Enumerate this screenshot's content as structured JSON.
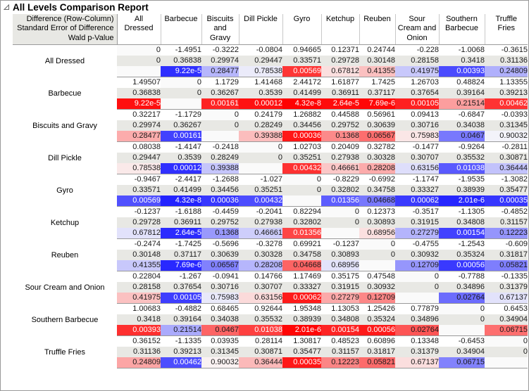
{
  "window": {
    "title": "All Levels Comparison Report",
    "disclosure_icon": "triangle-collapse-icon"
  },
  "table": {
    "legend_lines": [
      "Difference (Row-Column)",
      "Standard Error of Difference",
      "Wald p-Value"
    ],
    "columns": [
      "All Dressed",
      "Barbecue",
      "Biscuits and Gravy",
      "Dill Pickle",
      "Gyro",
      "Ketchup",
      "Reuben",
      "Sour Cream and Onion",
      "Southern Barbecue",
      "Truffle Fries"
    ],
    "rows": [
      {
        "label": "All Dressed",
        "difference": [
          "0",
          "-1.4951",
          "-0.3222",
          "-0.0804",
          "0.94665",
          "0.12371",
          "0.24744",
          "-0.228",
          "-1.0068",
          "-0.3615"
        ],
        "std_error": [
          "0",
          "0.36838",
          "0.29974",
          "0.29447",
          "0.33571",
          "0.29728",
          "0.30148",
          "0.28158",
          "0.3418",
          "0.31136"
        ],
        "p_value": [
          "",
          "9.22e-5",
          "0.28477",
          "0.78538",
          "0.00569",
          "0.67812",
          "0.41355",
          "0.41975",
          "0.00393",
          "0.24809"
        ]
      },
      {
        "label": "Barbecue",
        "difference": [
          "1.49507",
          "0",
          "1.1729",
          "1.41468",
          "2.44172",
          "1.61877",
          "1.7425",
          "1.26703",
          "0.48824",
          "1.13355"
        ],
        "std_error": [
          "0.36838",
          "0",
          "0.36267",
          "0.3539",
          "0.41499",
          "0.36911",
          "0.37117",
          "0.37654",
          "0.39164",
          "0.39213"
        ],
        "p_value": [
          "9.22e-5",
          "",
          "0.00161",
          "0.00012",
          "4.32e-8",
          "2.64e-5",
          "7.69e-6",
          "0.00105",
          "0.21514",
          "0.00462"
        ]
      },
      {
        "label": "Biscuits and Gravy",
        "difference": [
          "0.32217",
          "-1.1729",
          "0",
          "0.24179",
          "1.26882",
          "0.44588",
          "0.56961",
          "0.09413",
          "-0.6847",
          "-0.0393"
        ],
        "std_error": [
          "0.29974",
          "0.36267",
          "0",
          "0.28249",
          "0.34456",
          "0.29752",
          "0.30639",
          "0.30716",
          "0.34038",
          "0.31345"
        ],
        "p_value": [
          "0.28477",
          "0.00161",
          "",
          "0.39388",
          "0.00036",
          "0.1368",
          "0.06567",
          "0.75983",
          "0.0467",
          "0.90032"
        ]
      },
      {
        "label": "Dill Pickle",
        "difference": [
          "0.08038",
          "-1.4147",
          "-0.2418",
          "0",
          "1.02703",
          "0.20409",
          "0.32782",
          "-0.1477",
          "-0.9264",
          "-0.2811"
        ],
        "std_error": [
          "0.29447",
          "0.3539",
          "0.28249",
          "0",
          "0.35251",
          "0.27938",
          "0.30328",
          "0.30707",
          "0.35532",
          "0.30871"
        ],
        "p_value": [
          "0.78538",
          "0.00012",
          "0.39388",
          "",
          "0.00432",
          "0.46661",
          "0.28208",
          "0.63156",
          "0.01038",
          "0.36444"
        ]
      },
      {
        "label": "Gyro",
        "difference": [
          "-0.9467",
          "-2.4417",
          "-1.2688",
          "-1.027",
          "0",
          "-0.8229",
          "-0.6992",
          "-1.1747",
          "-1.9535",
          "-1.3082"
        ],
        "std_error": [
          "0.33571",
          "0.41499",
          "0.34456",
          "0.35251",
          "0",
          "0.32802",
          "0.34758",
          "0.33327",
          "0.38939",
          "0.35477"
        ],
        "p_value": [
          "0.00569",
          "4.32e-8",
          "0.00036",
          "0.00432",
          "",
          "0.01356",
          "0.04668",
          "0.00062",
          "2.01e-6",
          "0.00035"
        ]
      },
      {
        "label": "Ketchup",
        "difference": [
          "-0.1237",
          "-1.6188",
          "-0.4459",
          "-0.2041",
          "0.82294",
          "0",
          "0.12373",
          "-0.3517",
          "-1.1305",
          "-0.4852"
        ],
        "std_error": [
          "0.29728",
          "0.36911",
          "0.29752",
          "0.27938",
          "0.32802",
          "0",
          "0.30893",
          "0.31915",
          "0.34808",
          "0.31157"
        ],
        "p_value": [
          "0.67812",
          "2.64e-5",
          "0.1368",
          "0.46661",
          "0.01356",
          "",
          "0.68956",
          "0.27279",
          "0.00154",
          "0.12223"
        ]
      },
      {
        "label": "Reuben",
        "difference": [
          "-0.2474",
          "-1.7425",
          "-0.5696",
          "-0.3278",
          "0.69921",
          "-0.1237",
          "0",
          "-0.4755",
          "-1.2543",
          "-0.609"
        ],
        "std_error": [
          "0.30148",
          "0.37117",
          "0.30639",
          "0.30328",
          "0.34758",
          "0.30893",
          "0",
          "0.30932",
          "0.35324",
          "0.31817"
        ],
        "p_value": [
          "0.41355",
          "7.69e-6",
          "0.06567",
          "0.28208",
          "0.04668",
          "0.68956",
          "",
          "0.12709",
          "0.00056",
          "0.05821"
        ]
      },
      {
        "label": "Sour Cream and Onion",
        "difference": [
          "0.22804",
          "-1.267",
          "-0.0941",
          "0.14766",
          "1.17469",
          "0.35175",
          "0.47548",
          "0",
          "-0.7788",
          "-0.1335"
        ],
        "std_error": [
          "0.28158",
          "0.37654",
          "0.30716",
          "0.30707",
          "0.33327",
          "0.31915",
          "0.30932",
          "0",
          "0.34896",
          "0.31379"
        ],
        "p_value": [
          "0.41975",
          "0.00105",
          "0.75983",
          "0.63156",
          "0.00062",
          "0.27279",
          "0.12709",
          "",
          "0.02764",
          "0.67137"
        ]
      },
      {
        "label": "Southern Barbecue",
        "difference": [
          "1.00683",
          "-0.4882",
          "0.68465",
          "0.92644",
          "1.95348",
          "1.13053",
          "1.25426",
          "0.77879",
          "0",
          "0.6453"
        ],
        "std_error": [
          "0.3418",
          "0.39164",
          "0.34038",
          "0.35532",
          "0.38939",
          "0.34808",
          "0.35324",
          "0.34896",
          "0",
          "0.34904"
        ],
        "p_value": [
          "0.00393",
          "0.21514",
          "0.0467",
          "0.01038",
          "2.01e-6",
          "0.00154",
          "0.00056",
          "0.02764",
          "",
          "0.06715"
        ]
      },
      {
        "label": "Truffle Fries",
        "difference": [
          "0.36152",
          "-1.1335",
          "0.03935",
          "0.28114",
          "1.30817",
          "0.48523",
          "0.60896",
          "0.13348",
          "-0.6453",
          "0"
        ],
        "std_error": [
          "0.31136",
          "0.39213",
          "0.31345",
          "0.30871",
          "0.35477",
          "0.31157",
          "0.31817",
          "0.31379",
          "0.34904",
          "0"
        ],
        "p_value": [
          "0.24809",
          "0.00462",
          "0.90032",
          "0.36444",
          "0.00035",
          "0.12223",
          "0.05821",
          "0.67137",
          "0.06715",
          ""
        ]
      }
    ],
    "heat_colors": {
      "hot_max": "#FF0000",
      "cool_max": "#2222FF",
      "neutral": "#FAFAFA"
    }
  }
}
